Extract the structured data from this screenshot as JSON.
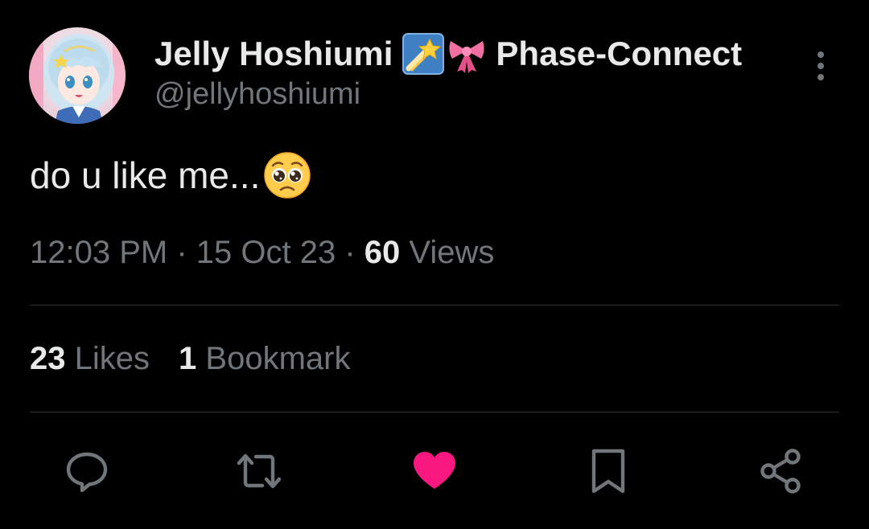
{
  "author": {
    "display_name": "Jelly Hoshiumi",
    "name_emojis": [
      "shooting-star-emoji",
      "ribbon-emoji"
    ],
    "affiliation": "Phase-Connect",
    "handle": "@jellyhoshiumi",
    "avatar": "avatar-illustration"
  },
  "tweet": {
    "text": "do u like me...",
    "text_emoji": "pleading-face-emoji"
  },
  "meta": {
    "time": "12:03 PM",
    "separator": "·",
    "date": "15 Oct 23",
    "views_count": "60",
    "views_label": "Views"
  },
  "stats": {
    "likes_count": "23",
    "likes_label": "Likes",
    "bookmarks_count": "1",
    "bookmarks_label": "Bookmark"
  },
  "actions": [
    {
      "name": "reply",
      "icon": "reply-icon"
    },
    {
      "name": "retweet",
      "icon": "retweet-icon"
    },
    {
      "name": "like",
      "icon": "heart-icon",
      "active": true
    },
    {
      "name": "bookmark",
      "icon": "bookmark-icon"
    },
    {
      "name": "share",
      "icon": "share-icon"
    }
  ],
  "colors": {
    "background": "#000000",
    "primary_text": "#e7e9ea",
    "secondary_text": "#71767b",
    "divider": "#2f3336",
    "like_active": "#f91880"
  }
}
